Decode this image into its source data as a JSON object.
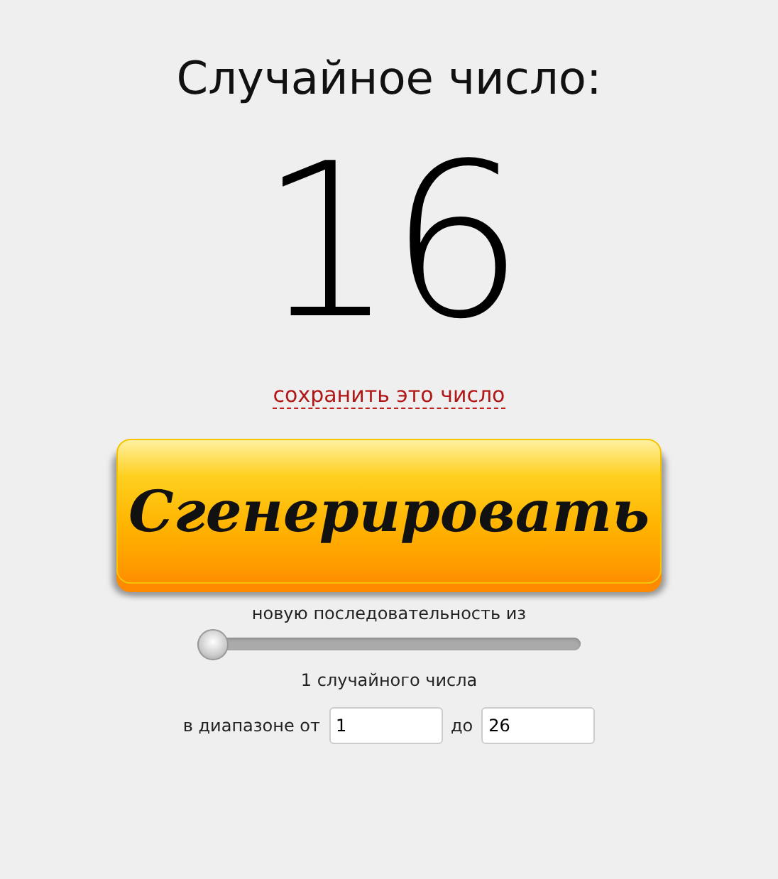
{
  "title": "Случайное число:",
  "result": "16",
  "save_link": "сохранить это число",
  "generate_button": "Сгенерировать",
  "sequence_label": "новую последовательность из",
  "count_slider": {
    "level": 0
  },
  "count_label": "1 случайного числа",
  "range": {
    "label_from": "в диапазоне от",
    "from_value": "1",
    "label_to": "до",
    "to_value": "26"
  }
}
